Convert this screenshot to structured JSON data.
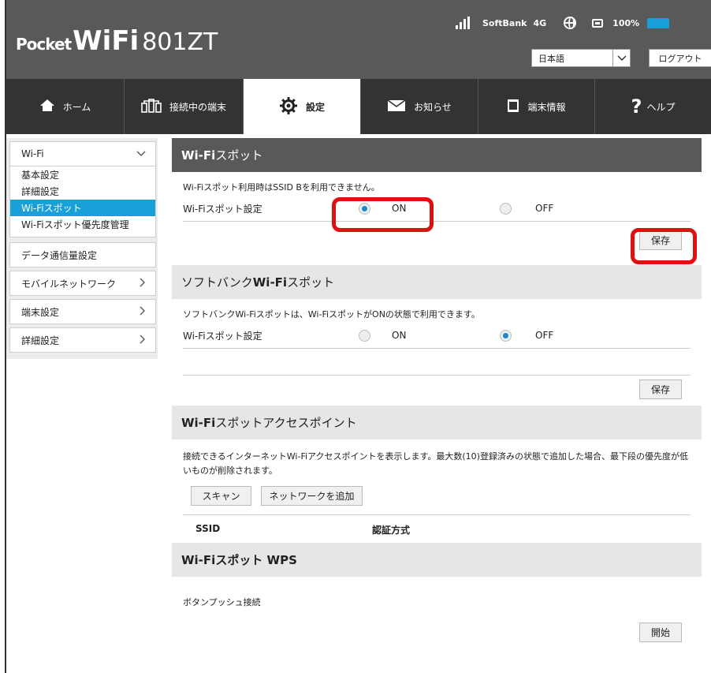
{
  "header": {
    "logo_pocket": "Pocket",
    "logo_wifi": "WiFi",
    "logo_model": "801ZT",
    "carrier": "SoftBank",
    "network": "4G",
    "battery": "100%",
    "language": "日本語",
    "logout": "ログアウト"
  },
  "nav": {
    "tabs": [
      {
        "label": "ホーム",
        "icon": "home-icon"
      },
      {
        "label": "接続中の端末",
        "icon": "devices-icon"
      },
      {
        "label": "設定",
        "icon": "gear-icon"
      },
      {
        "label": "お知らせ",
        "icon": "mail-icon"
      },
      {
        "label": "端末情報",
        "icon": "info-icon"
      },
      {
        "label": "ヘルプ",
        "icon": "help-icon"
      }
    ],
    "active": "設定"
  },
  "sidebar": {
    "wifi": "Wi-Fi",
    "wifi_subs": [
      "基本設定",
      "詳細設定",
      "Wi-Fiスポット",
      "Wi-Fiスポット優先度管理"
    ],
    "items": [
      "データ通信量設定",
      "モバイルネットワーク",
      "端末設定",
      "詳細設定"
    ]
  },
  "sections": {
    "spot": {
      "title_bold": "Wi-Fi",
      "title_rest": "スポット",
      "desc": "Wi-Fiスポット利用時はSSID Bを利用できません。",
      "setting_label": "Wi-Fiスポット設定",
      "on": "ON",
      "off": "OFF",
      "save": "保存"
    },
    "softbank": {
      "title_pre": "ソフトバンク",
      "title_bold": "Wi-Fi",
      "title_rest": "スポット",
      "desc": "ソフトバンクWi-Fiスポットは、Wi-FiスポットがONの状態で利用できます。",
      "setting_label": "Wi-Fiスポット設定",
      "on": "ON",
      "off": "OFF",
      "save": "保存"
    },
    "ap": {
      "title_bold": "Wi-Fi",
      "title_rest": "スポットアクセスポイント",
      "desc": "接続できるインターネットWi-Fiアクセスポイントを表示します。最大数(10)登録済みの状態で追加した場合、最下段の優先度が低いものが削除されます。",
      "scan": "スキャン",
      "add": "ネットワークを追加",
      "col_ssid": "SSID",
      "col_auth": "認証方式"
    },
    "wps": {
      "title_bold": "Wi-Fi",
      "title_rest": "スポット WPS",
      "desc": "ボタンプッシュ接続",
      "start": "開始"
    }
  }
}
